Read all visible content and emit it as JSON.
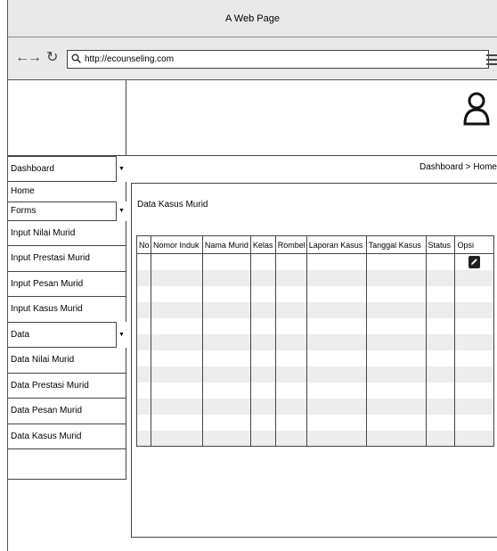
{
  "window": {
    "title": "A Web Page"
  },
  "browser": {
    "url": "http://ecounseling.com"
  },
  "breadcrumb": "Dashboard > Home",
  "sidebar": {
    "items": [
      {
        "label": "Dashboard",
        "type": "dropdown"
      },
      {
        "label": "Home",
        "type": "sub"
      },
      {
        "label": "Forms",
        "type": "dropdown"
      },
      {
        "label": "Input Nilai Murid",
        "type": "item"
      },
      {
        "label": "Input Prestasi Murid",
        "type": "item"
      },
      {
        "label": "Input Pesan Murid",
        "type": "item"
      },
      {
        "label": "Input Kasus Murid",
        "type": "item"
      },
      {
        "label": "Data",
        "type": "dropdown"
      },
      {
        "label": "Data Nilai Murid",
        "type": "item"
      },
      {
        "label": "Data Prestasi Murid",
        "type": "item"
      },
      {
        "label": "Data Pesan Murid",
        "type": "item"
      },
      {
        "label": "Data Kasus Murid",
        "type": "item"
      }
    ]
  },
  "content": {
    "title": "Data Kasus Murid",
    "table": {
      "columns": [
        "No",
        "Nomor Induk",
        "Nama Murid",
        "Kelas",
        "Rombel",
        "Laporan Kasus",
        "Tanggal Kasus",
        "Status",
        "Opsi"
      ]
    }
  },
  "icons": {
    "back": "arrow-left-icon",
    "forward": "arrow-right-icon",
    "reload": "reload-icon",
    "search": "search-icon",
    "menu": "hamburger-menu-icon",
    "avatar": "user-avatar-icon",
    "edit": "edit-pencil-icon",
    "dropdown": "dropdown-arrow-icon"
  }
}
